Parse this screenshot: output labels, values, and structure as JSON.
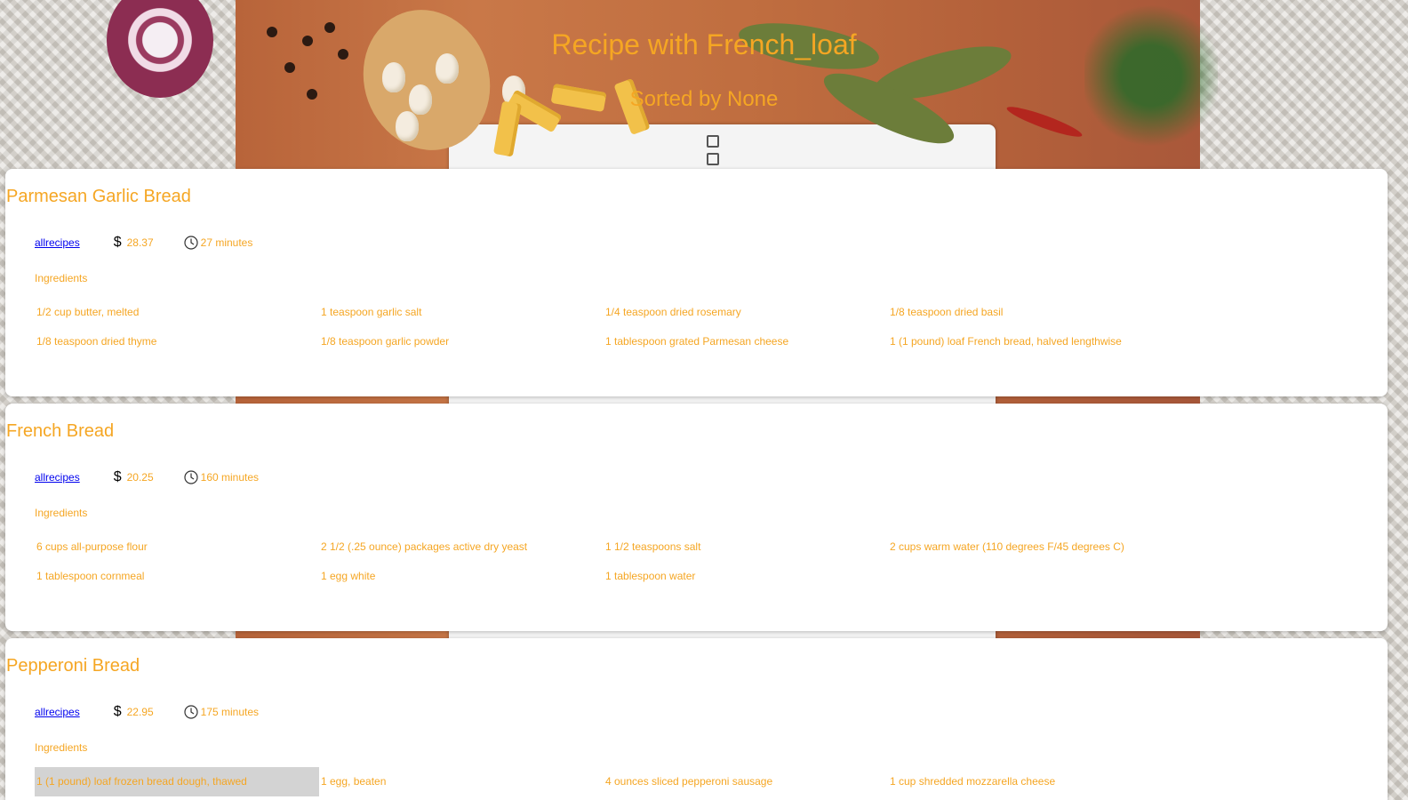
{
  "header": {
    "title": "Recipe with French_loaf",
    "subtitle": "Sorted by None"
  },
  "recipes": [
    {
      "title": "Parmesan Garlic Bread",
      "source": "allrecipes",
      "price": "28.37",
      "time": "27 minutes",
      "ingredients_label": "Ingredients",
      "ingredients": [
        "1/2 cup butter, melted",
        "1 teaspoon garlic salt",
        "1/4 teaspoon dried rosemary",
        "1/8 teaspoon dried basil",
        "1/8 teaspoon dried thyme",
        "1/8 teaspoon garlic powder",
        "1 tablespoon grated Parmesan cheese",
        "1 (1 pound) loaf French bread, halved lengthwise"
      ]
    },
    {
      "title": "French Bread",
      "source": "allrecipes",
      "price": "20.25",
      "time": "160 minutes",
      "ingredients_label": "Ingredients",
      "ingredients": [
        "6 cups all-purpose flour",
        "2 1/2 (.25 ounce) packages active dry yeast",
        "1 1/2 teaspoons salt",
        "2 cups warm water (110 degrees F/45 degrees C)",
        "1 tablespoon cornmeal",
        "1 egg white",
        "1 tablespoon water"
      ]
    },
    {
      "title": "Pepperoni Bread",
      "source": "allrecipes",
      "price": "22.95",
      "time": "175 minutes",
      "ingredients_label": "Ingredients",
      "ingredients": [
        "1 (1 pound) loaf frozen bread dough, thawed",
        "1 egg, beaten",
        "4 ounces sliced pepperoni sausage",
        "1 cup shredded mozzarella cheese"
      ]
    }
  ],
  "icons": {
    "price": "dollar-icon",
    "time": "clock-icon"
  },
  "colors": {
    "accent": "#f5a623",
    "link": "#0000ee",
    "hover": "#d3d3d3"
  }
}
